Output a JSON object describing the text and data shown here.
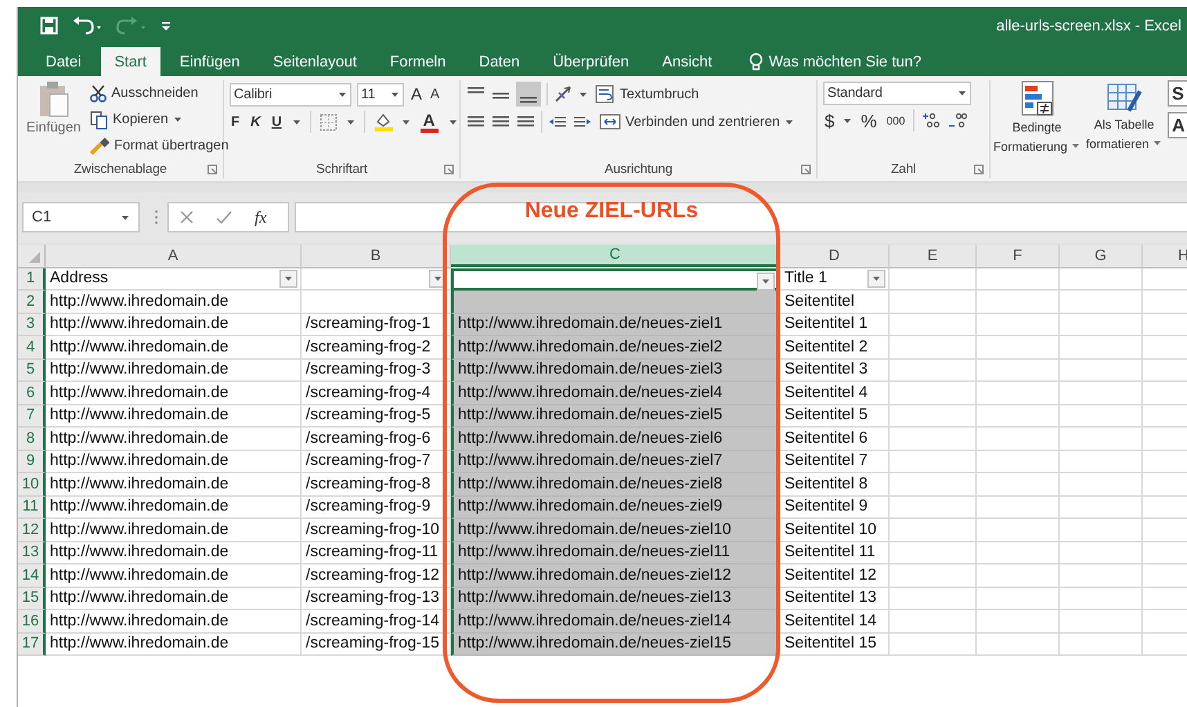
{
  "quick_access": [
    {
      "kind": "save",
      "disabled": false
    },
    {
      "kind": "undo",
      "disabled": false
    },
    {
      "kind": "redo",
      "disabled": true
    },
    {
      "kind": "customize",
      "disabled": false
    }
  ],
  "title": "alle-urls-screen.xlsx - Excel",
  "tabs": [
    {
      "label": "Datei",
      "selected": false
    },
    {
      "label": "Start",
      "selected": true
    },
    {
      "label": "Einfügen",
      "selected": false
    },
    {
      "label": "Seitenlayout",
      "selected": false
    },
    {
      "label": "Formeln",
      "selected": false
    },
    {
      "label": "Daten",
      "selected": false
    },
    {
      "label": "Überprüfen",
      "selected": false
    },
    {
      "label": "Ansicht",
      "selected": false
    }
  ],
  "tell_me": "Was möchten Sie tun?",
  "ribbon": {
    "clipboard": {
      "label": "Zwischenablage",
      "paste": "Einfügen",
      "cut": "Ausschneiden",
      "copy": "Kopieren",
      "format_painter": "Format übertragen"
    },
    "font": {
      "label": "Schriftart",
      "name": "Calibri",
      "size": "11",
      "grow": "A",
      "shrink": "A",
      "bold": "F",
      "italic": "K",
      "underline": "U",
      "font_color": "A"
    },
    "alignment": {
      "label": "Ausrichtung",
      "wrap_text": "Textumbruch",
      "merge_center": "Verbinden und zentrieren"
    },
    "number": {
      "label": "Zahl",
      "format": "Standard",
      "currency": "$",
      "percent": "%",
      "thousands": "000"
    },
    "styles": {
      "conditional": [
        "Bedingte",
        "Formatierung"
      ],
      "as_table": [
        "Als Tabelle",
        "formatieren"
      ],
      "gallery": [
        "S",
        "A"
      ]
    }
  },
  "formula_bar": {
    "name_box": "C1",
    "function_label": "fx"
  },
  "sheet": {
    "columns": [
      {
        "letter": "A",
        "selected": false,
        "filter": true
      },
      {
        "letter": "B",
        "selected": false,
        "filter": true
      },
      {
        "letter": "C",
        "selected": true,
        "filter": true
      },
      {
        "letter": "D",
        "selected": false,
        "filter": true
      },
      {
        "letter": "E",
        "selected": false,
        "filter": false
      },
      {
        "letter": "F",
        "selected": false,
        "filter": false
      },
      {
        "letter": "G",
        "selected": false,
        "filter": false
      },
      {
        "letter": "H",
        "selected": false,
        "filter": false
      }
    ],
    "rows": [
      {
        "number": "1",
        "selected": true,
        "cells": {
          "A": "Address",
          "D": "Title 1"
        }
      },
      {
        "number": "2",
        "selected": true,
        "cells": {
          "A": "http://www.ihredomain.de",
          "D": "Seitentitel"
        }
      },
      {
        "number": "3",
        "selected": true,
        "cells": {
          "A": "http://www.ihredomain.de",
          "B": "/screaming-frog-1",
          "C": "http://www.ihredomain.de/neues-ziel1",
          "D": "Seitentitel 1"
        }
      },
      {
        "number": "4",
        "selected": true,
        "cells": {
          "A": "http://www.ihredomain.de",
          "B": "/screaming-frog-2",
          "C": "http://www.ihredomain.de/neues-ziel2",
          "D": "Seitentitel 2"
        }
      },
      {
        "number": "5",
        "selected": true,
        "cells": {
          "A": "http://www.ihredomain.de",
          "B": "/screaming-frog-3",
          "C": "http://www.ihredomain.de/neues-ziel3",
          "D": "Seitentitel 3"
        }
      },
      {
        "number": "6",
        "selected": true,
        "cells": {
          "A": "http://www.ihredomain.de",
          "B": "/screaming-frog-4",
          "C": "http://www.ihredomain.de/neues-ziel4",
          "D": "Seitentitel 4"
        }
      },
      {
        "number": "7",
        "selected": true,
        "cells": {
          "A": "http://www.ihredomain.de",
          "B": "/screaming-frog-5",
          "C": "http://www.ihredomain.de/neues-ziel5",
          "D": "Seitentitel 5"
        }
      },
      {
        "number": "8",
        "selected": true,
        "cells": {
          "A": "http://www.ihredomain.de",
          "B": "/screaming-frog-6",
          "C": "http://www.ihredomain.de/neues-ziel6",
          "D": "Seitentitel 6"
        }
      },
      {
        "number": "9",
        "selected": true,
        "cells": {
          "A": "http://www.ihredomain.de",
          "B": "/screaming-frog-7",
          "C": "http://www.ihredomain.de/neues-ziel7",
          "D": "Seitentitel 7"
        }
      },
      {
        "number": "10",
        "selected": true,
        "cells": {
          "A": "http://www.ihredomain.de",
          "B": "/screaming-frog-8",
          "C": "http://www.ihredomain.de/neues-ziel8",
          "D": "Seitentitel 8"
        }
      },
      {
        "number": "11",
        "selected": true,
        "cells": {
          "A": "http://www.ihredomain.de",
          "B": "/screaming-frog-9",
          "C": "http://www.ihredomain.de/neues-ziel9",
          "D": "Seitentitel 9"
        }
      },
      {
        "number": "12",
        "selected": true,
        "cells": {
          "A": "http://www.ihredomain.de",
          "B": "/screaming-frog-10",
          "C": "http://www.ihredomain.de/neues-ziel10",
          "D": "Seitentitel 10"
        }
      },
      {
        "number": "13",
        "selected": true,
        "cells": {
          "A": "http://www.ihredomain.de",
          "B": "/screaming-frog-11",
          "C": "http://www.ihredomain.de/neues-ziel11",
          "D": "Seitentitel 11"
        }
      },
      {
        "number": "14",
        "selected": true,
        "cells": {
          "A": "http://www.ihredomain.de",
          "B": "/screaming-frog-12",
          "C": "http://www.ihredomain.de/neues-ziel12",
          "D": "Seitentitel 12"
        }
      },
      {
        "number": "15",
        "selected": true,
        "cells": {
          "A": "http://www.ihredomain.de",
          "B": "/screaming-frog-13",
          "C": "http://www.ihredomain.de/neues-ziel13",
          "D": "Seitentitel 13"
        }
      },
      {
        "number": "16",
        "selected": true,
        "cells": {
          "A": "http://www.ihredomain.de",
          "B": "/screaming-frog-14",
          "C": "http://www.ihredomain.de/neues-ziel14",
          "D": "Seitentitel 14"
        }
      },
      {
        "number": "17",
        "selected": true,
        "cells": {
          "A": "http://www.ihredomain.de",
          "B": "/screaming-frog-15",
          "C": "http://www.ihredomain.de/neues-ziel15",
          "D": "Seitentitel 15"
        }
      }
    ]
  },
  "callout": {
    "label": "Neue ZIEL-URLs"
  }
}
